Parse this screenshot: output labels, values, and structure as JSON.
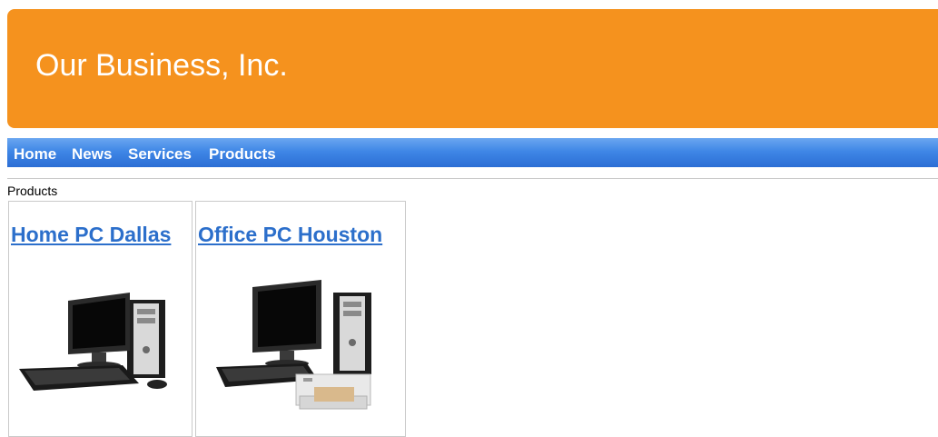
{
  "header": {
    "title": "Our Business, Inc."
  },
  "nav": {
    "items": [
      {
        "label": "Home"
      },
      {
        "label": "News"
      },
      {
        "label": "Services"
      },
      {
        "label": "Products"
      }
    ]
  },
  "breadcrumb": "Products",
  "products": [
    {
      "title": "Home PC Dallas",
      "image": "desktop-computer-icon"
    },
    {
      "title": "Office PC Houston",
      "image": "desktop-computer-with-printer-icon"
    }
  ],
  "colors": {
    "header_bg": "#f5921e",
    "nav_bg": "#3f87e6",
    "link": "#2c6fcb"
  }
}
